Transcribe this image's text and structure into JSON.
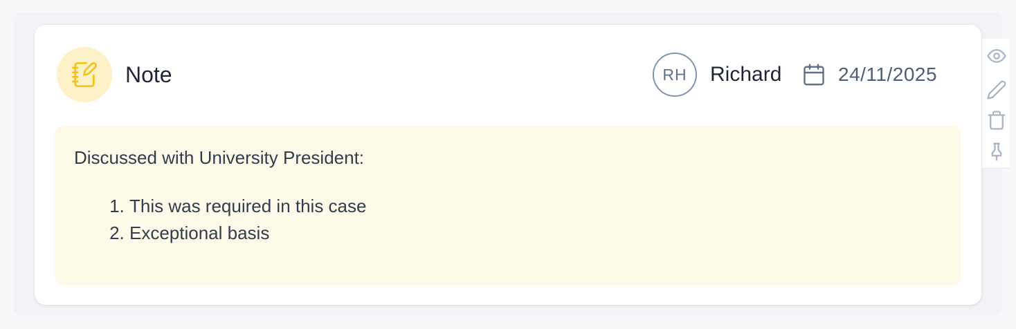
{
  "note": {
    "type_label": "Note",
    "type_icon": "notebook-pen-icon",
    "accent_color": "#f2c21b",
    "badge_bg": "#fdf1c8",
    "author_initials": "RH",
    "author_name": "Richard",
    "date_icon": "calendar-icon",
    "date": "24/11/2025",
    "body": {
      "intro": "Discussed with University President:",
      "points": [
        "This was required in this case",
        "Exceptional basis"
      ],
      "bg_color": "#fefaea"
    }
  },
  "actions": [
    {
      "name": "view",
      "icon": "eye-icon"
    },
    {
      "name": "edit",
      "icon": "pencil-icon"
    },
    {
      "name": "delete",
      "icon": "trash-icon"
    },
    {
      "name": "pin",
      "icon": "pin-icon"
    }
  ]
}
